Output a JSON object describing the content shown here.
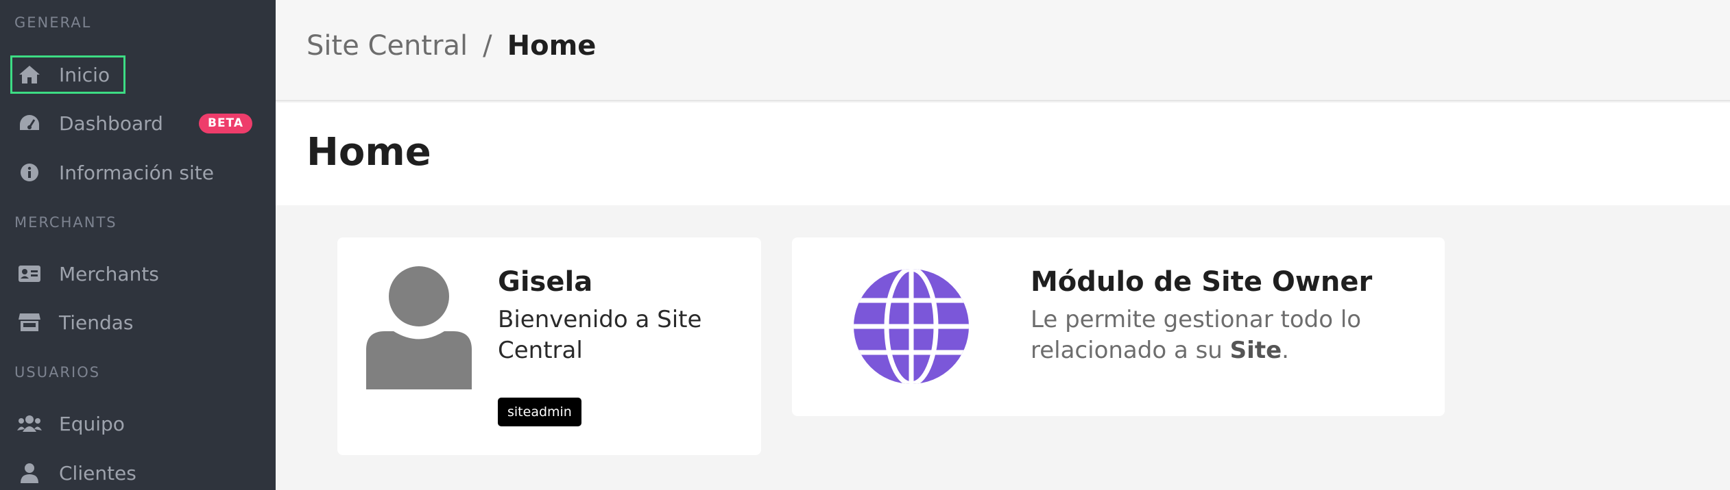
{
  "sidebar": {
    "sections": [
      {
        "title": "GENERAL"
      },
      {
        "title": "MERCHANTS"
      },
      {
        "title": "USUARIOS"
      }
    ],
    "items": [
      {
        "label": "Inicio",
        "icon": "home-icon"
      },
      {
        "label": "Dashboard",
        "icon": "dashboard-icon",
        "badge": "BETA"
      },
      {
        "label": "Información site",
        "icon": "info-icon"
      },
      {
        "label": "Merchants",
        "icon": "id-card-icon"
      },
      {
        "label": "Tiendas",
        "icon": "store-icon"
      },
      {
        "label": "Equipo",
        "icon": "team-icon"
      },
      {
        "label": "Clientes",
        "icon": "user-icon"
      }
    ]
  },
  "breadcrumb": {
    "parent": "Site Central",
    "separator": "/",
    "current": "Home"
  },
  "page": {
    "title": "Home"
  },
  "user_card": {
    "name": "Gisela",
    "welcome": "Bienvenido a Site Central",
    "role": "siteadmin"
  },
  "module_card": {
    "title": "Módulo de Site Owner",
    "desc_prefix": "Le permite gestionar todo lo relacionado a su ",
    "desc_strong": "Site",
    "desc_suffix": "."
  },
  "colors": {
    "sidebar_bg": "#2f343d",
    "accent_purple": "#7b57d9",
    "beta_badge": "#ee3d6b",
    "active_outline": "#3ddc84"
  }
}
